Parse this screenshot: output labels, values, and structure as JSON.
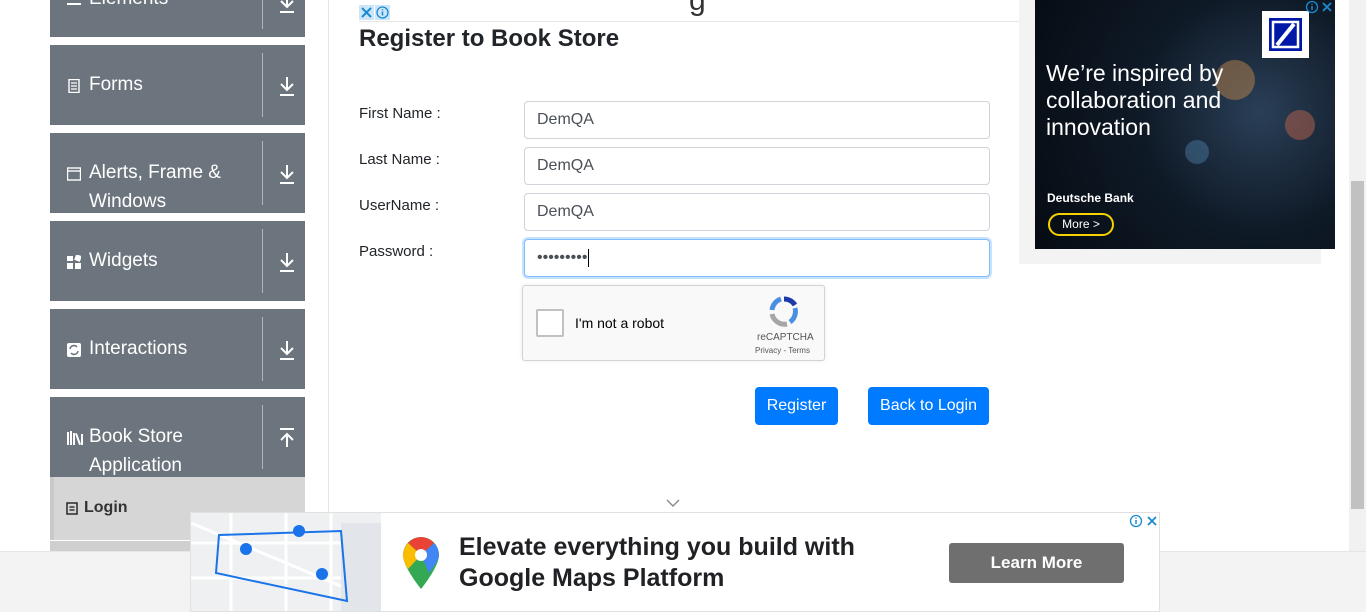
{
  "sidebar": {
    "groups": [
      {
        "label": "Elements",
        "icon": "list-icon",
        "arrow": "download-arrow-icon"
      },
      {
        "label": "Forms",
        "icon": "file-icon",
        "arrow": "download-arrow-icon"
      },
      {
        "label": "Alerts, Frame & Windows",
        "icon": "window-icon",
        "arrow": "download-arrow-icon"
      },
      {
        "label": "Widgets",
        "icon": "widgets-icon",
        "arrow": "download-arrow-icon"
      },
      {
        "label": "Interactions",
        "icon": "sync-icon",
        "arrow": "download-arrow-icon"
      },
      {
        "label": "Book Store Application",
        "icon": "books-icon",
        "arrow": "upload-arrow-icon"
      }
    ],
    "active_item": {
      "label": "Login",
      "icon": "login-icon"
    }
  },
  "top_ad": {
    "partial_text": "g"
  },
  "form": {
    "title": "Register to Book Store",
    "fields": [
      {
        "label": "First Name :",
        "value": "DemQA"
      },
      {
        "label": "Last Name :",
        "value": "DemQA"
      },
      {
        "label": "UserName :",
        "value": "DemQA"
      },
      {
        "label": "Password :",
        "value": "•••••••••"
      }
    ],
    "captcha": {
      "label": "I'm not a robot",
      "brand": "reCAPTCHA",
      "links": "Privacy - Terms"
    },
    "register_label": "Register",
    "back_label": "Back to Login"
  },
  "right_ad": {
    "headline": "We’re inspired by collaboration and innovation",
    "brand": "Deutsche Bank",
    "cta": "More >"
  },
  "bottom_ad": {
    "headline": "Elevate everything you build with Google Maps Platform",
    "cta": "Learn More"
  },
  "colors": {
    "primary": "#007bff",
    "sidebar": "#6c757d",
    "active": "#d6d6d6"
  }
}
